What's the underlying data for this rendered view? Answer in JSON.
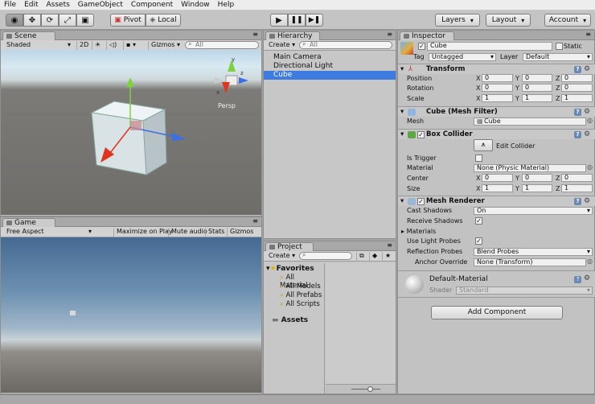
{
  "menu": [
    "File",
    "Edit",
    "Assets",
    "GameObject",
    "Component",
    "Window",
    "Help"
  ],
  "toolbar": {
    "pivot": "Pivot",
    "local": "Local",
    "layers": "Layers",
    "layout": "Layout",
    "account": "Account",
    "play_icon": "play-icon",
    "pause_icon": "pause-icon",
    "step_icon": "step-icon"
  },
  "scene": {
    "tab": "Scene",
    "shading": "Shaded",
    "mode2d": "2D",
    "gizmos": "Gizmos",
    "search_placeholder": "All",
    "persp": "Persp"
  },
  "game": {
    "tab": "Game",
    "aspect": "Free Aspect",
    "maximize": "Maximize on Play",
    "mute": "Mute audio",
    "stats": "Stats",
    "gizmos": "Gizmos"
  },
  "hierarchy": {
    "tab": "Hierarchy",
    "create": "Create",
    "search_placeholder": "All",
    "items": [
      "Main Camera",
      "Directional Light",
      "Cube"
    ],
    "selected": "Cube"
  },
  "project": {
    "tab": "Project",
    "create": "Create",
    "favorites": "Favorites",
    "favorite_items": [
      "All Material",
      "All Models",
      "All Prefabs",
      "All Scripts"
    ],
    "assets": "Assets"
  },
  "inspector": {
    "tab": "Inspector",
    "object_name": "Cube",
    "static": "Static",
    "tag_label": "Tag",
    "tag_value": "Untagged",
    "layer_label": "Layer",
    "layer_value": "Default",
    "transform": {
      "title": "Transform",
      "position_label": "Position",
      "rotation_label": "Rotation",
      "scale_label": "Scale",
      "position": [
        "0",
        "0",
        "0"
      ],
      "rotation": [
        "0",
        "0",
        "0"
      ],
      "scale": [
        "1",
        "1",
        "1"
      ]
    },
    "mesh_filter": {
      "title": "Cube (Mesh Filter)",
      "mesh_label": "Mesh",
      "mesh_value": "Cube"
    },
    "box_collider": {
      "title": "Box Collider",
      "edit_collider": "Edit Collider",
      "is_trigger_label": "Is Trigger",
      "material_label": "Material",
      "material_value": "None (Physic Material)",
      "center_label": "Center",
      "size_label": "Size",
      "center": [
        "0",
        "0",
        "0"
      ],
      "size": [
        "1",
        "1",
        "1"
      ]
    },
    "mesh_renderer": {
      "title": "Mesh Renderer",
      "cast_shadows_label": "Cast Shadows",
      "cast_shadows_value": "On",
      "receive_shadows_label": "Receive Shadows",
      "materials_label": "Materials",
      "use_light_probes_label": "Use Light Probes",
      "reflection_probes_label": "Reflection Probes",
      "reflection_probes_value": "Blend Probes",
      "anchor_override_label": "Anchor Override",
      "anchor_override_value": "None (Transform)"
    },
    "material": {
      "name": "Default-Material",
      "shader_label": "Shader",
      "shader_value": "Standard"
    },
    "add_component": "Add Component"
  },
  "axis": {
    "x": "X",
    "y": "Y",
    "z": "Z"
  },
  "colors": {
    "selection": "#3e7ce2",
    "x_axis": "#e0341f",
    "y_axis": "#7cd23c",
    "z_axis": "#3b6fe6"
  }
}
